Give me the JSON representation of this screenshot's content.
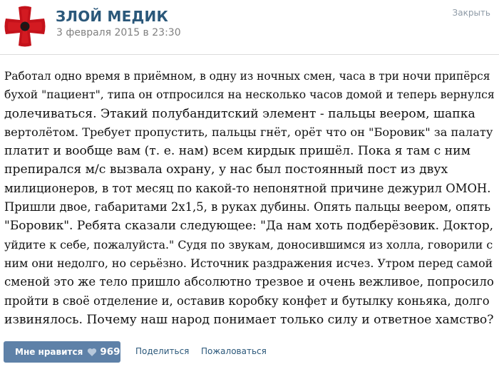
{
  "header": {
    "author": "ЗЛОЙ МЕДИК",
    "date": "3 февраля 2015 в 23:30",
    "close_label": "Закрыть"
  },
  "post": {
    "lines": [
      "Работал одно время в приёмном, в одну из ночных смен, часа в три ночи припёрся",
      "бухой \"пациент\", типа он отпросился на несколько часов домой и теперь вернулся",
      "долечиваться. Этакий полубандитский элемент - пальцы веером, шапка",
      "вертолётом. Требует пропустить, пальцы гнёт, орёт что он \"Боровик\" за палату",
      "платит и вообще вам (т. е. нам) всем кирдык пришёл. Пока я там с ним",
      "препирался м/с вызвала охрану, у нас был постоянный пост из двух",
      "милиционеров, в тот месяц по какой-то непонятной причине дежурил ОМОН.",
      "Пришли двое, габаритами 2х1,5, в руках дубины. Опять пальцы веером, опять",
      "\"Боровик\". Ребята сказали следующее: \"Да нам хоть подберёзовик. Доктор,",
      "уйдите к себе, пожалуйста.\" Судя по звукам, доносившимся из холла, говорили с",
      "ним они недолго, но серьёзно. Источник раздражения исчез. Утром перед самой",
      "сменой это же тело пришло абсолютно трезвое и очень вежливое, попросило",
      "пройти в своё отделение и, оставив коробку конфет и бутылку коньяка, долго",
      "извинялось. Почему наш народ понимает только силу и ответное хамство?"
    ]
  },
  "footer": {
    "like_label": "Мне нравится",
    "like_count": "969",
    "share_label": "Поделиться",
    "report_label": "Пожаловаться"
  },
  "colors": {
    "link": "#2b587a",
    "like_button": "#5e81a8",
    "avatar_red": "#c4121b"
  },
  "icons": {
    "avatar": "red-cross-avatar-icon",
    "like": "heart-icon"
  }
}
